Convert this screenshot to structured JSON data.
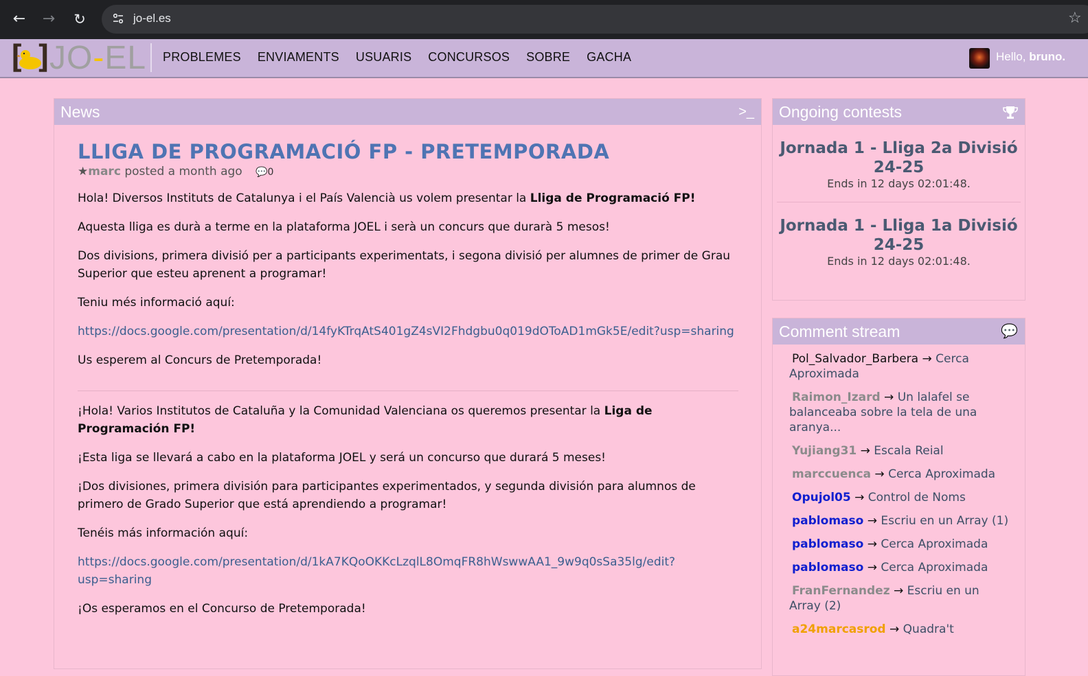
{
  "browser": {
    "url": "jo-el.es"
  },
  "header": {
    "logo_text_left": "JO",
    "logo_text_dash": "-",
    "logo_text_right": "EL",
    "nav": [
      "PROBLEMES",
      "ENVIAMENTS",
      "USUARIS",
      "CONCURSOS",
      "SOBRE",
      "GACHA"
    ],
    "greeting": "Hello,",
    "username": "bruno."
  },
  "news": {
    "title": "News",
    "post": {
      "title": "LLIGA DE PROGRAMACIÓ FP - PRETEMPORADA",
      "author": "marc",
      "posted": "posted a month ago",
      "comment_count": "0",
      "p1_text": "Hola! Diversos Instituts de Catalunya i el País Valencià us volem presentar la ",
      "p1_bold": "Lliga de Programació FP!",
      "p2": "Aquesta lliga es durà a terme en la plataforma JOEL i serà un concurs que durarà 5 mesos!",
      "p3": "Dos divisions, primera divisió per a participants experimentats, i segona divisió per alumnes de primer de Grau Superior que esteu aprenent a programar!",
      "p4": "Teniu més informació aquí:",
      "link1": "https://docs.google.com/presentation/d/14fyKTrqAtS401gZ4sVI2Fhdgbu0q019dOToAD1mGk5E/edit?usp=sharing",
      "p5": "Us esperem al Concurs de Pretemporada!",
      "es_p1_text": "¡Hola! Varios Institutos de Cataluña y la Comunidad Valenciana os queremos presentar la ",
      "es_p1_bold": "Liga de Programación FP!",
      "es_p2": "¡Esta liga se llevará a cabo en la plataforma JOEL y será un concurso que durará 5 meses!",
      "es_p3": "¡Dos divisiones, primera división para participantes experimentados, y segunda división para alumnos de primero de Grado Superior que está aprendiendo a programar!",
      "es_p4": "Tenéis más información aquí:",
      "link2": "https://docs.google.com/presentation/d/1kA7KQoOKKcLzqlL8OmqFR8hWswwAA1_9w9q0sSa35lg/edit?usp=sharing",
      "es_p5": "¡Os esperamos en el Concurso de Pretemporada!"
    }
  },
  "contests": {
    "title": "Ongoing contests",
    "items": [
      {
        "name": "Jornada 1 - Lliga 2a Divisió 24-25",
        "ends": "Ends in 12 days 02:01:48."
      },
      {
        "name": "Jornada 1 - Lliga 1a Divisió 24-25",
        "ends": "Ends in 12 days 02:01:48."
      }
    ]
  },
  "comments": {
    "title": "Comment stream",
    "arrow": "→",
    "items": [
      {
        "user": "Pol_Salvador_Barbera",
        "target": "Cerca Aproximada",
        "color": "#111111"
      },
      {
        "user": "Raimon_Izard",
        "target": "Un lalafel se balanceaba sobre la tela de una aranya...",
        "color": "#8b8b8b"
      },
      {
        "user": "Yujiang31",
        "target": "Escala Reial",
        "color": "#8b8b8b"
      },
      {
        "user": "marccuenca",
        "target": "Cerca Aproximada",
        "color": "#8b8b8b"
      },
      {
        "user": "Opujol05",
        "target": "Control de Noms",
        "color": "#0f1fcf"
      },
      {
        "user": "pablomaso",
        "target": "Escriu en un Array (1)",
        "color": "#0f1fcf"
      },
      {
        "user": "pablomaso",
        "target": "Cerca Aproximada",
        "color": "#0f1fcf"
      },
      {
        "user": "pablomaso",
        "target": "Cerca Aproximada",
        "color": "#0f1fcf"
      },
      {
        "user": "FranFernandez",
        "target": "Escriu en un Array (2)",
        "color": "#8b8b8b"
      },
      {
        "user": "a24marcasrod",
        "target": "Quadra't",
        "color": "#f0a000"
      }
    ]
  }
}
